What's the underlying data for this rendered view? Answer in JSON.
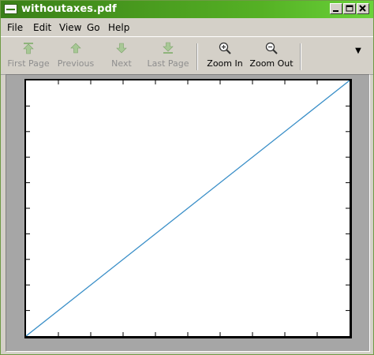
{
  "window": {
    "title": "withoutaxes.pdf"
  },
  "menubar": {
    "items": [
      {
        "label": "File"
      },
      {
        "label": "Edit"
      },
      {
        "label": "View"
      },
      {
        "label": "Go"
      },
      {
        "label": "Help"
      }
    ]
  },
  "toolbar": {
    "buttons": [
      {
        "label": "First Page",
        "icon": "first-page-icon",
        "enabled": false
      },
      {
        "label": "Previous",
        "icon": "previous-icon",
        "enabled": false
      },
      {
        "label": "Next",
        "icon": "next-icon",
        "enabled": false
      },
      {
        "label": "Last Page",
        "icon": "last-page-icon",
        "enabled": false
      },
      {
        "label": "Zoom In",
        "icon": "zoom-in-icon",
        "enabled": true
      },
      {
        "label": "Zoom Out",
        "icon": "zoom-out-icon",
        "enabled": true
      }
    ],
    "overflow_glyph": "▼"
  },
  "document": {
    "line_color": "#3a8fc8",
    "chart_data": {
      "type": "line",
      "x": [
        0,
        1
      ],
      "y": [
        0,
        1
      ],
      "xlim": [
        0,
        1
      ],
      "ylim": [
        0,
        1
      ],
      "grid": false
    }
  },
  "colors": {
    "titlebar_start": "#3a7f18",
    "titlebar_end": "#6ad33a",
    "chrome": "#d4d0c8",
    "viewport": "#a6a6a6",
    "disabled_text": "#8e8e8e"
  }
}
